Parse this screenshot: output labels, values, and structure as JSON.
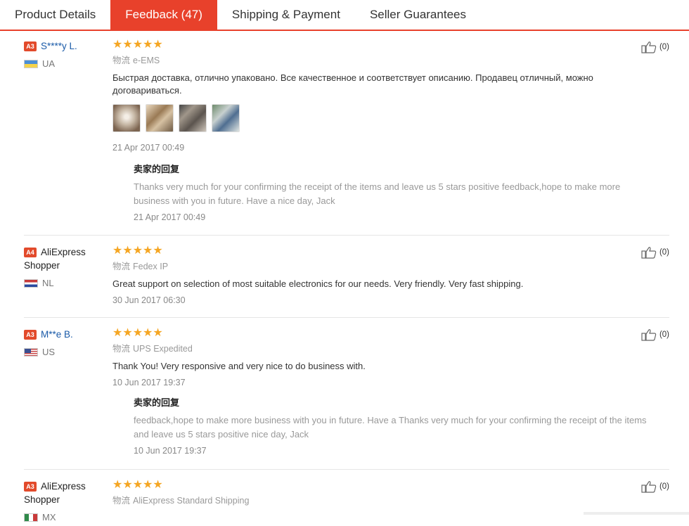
{
  "tabs": [
    {
      "label": "Product Details"
    },
    {
      "label": "Feedback (47)"
    },
    {
      "label": "Shipping & Payment"
    },
    {
      "label": "Seller Guarantees"
    }
  ],
  "rating_stars": "★★★★★",
  "shipping_label": "物流",
  "reply_title": "卖家的回复",
  "reviews": [
    {
      "badge": "A3",
      "name": "S****y L.",
      "country": "UA",
      "shipping": "e-EMS",
      "text": "Быстрая доставка, отлично упаковано. Все качественное и соответствует описанию. Продавец отличный, можно договариваться.",
      "date": "21 Apr 2017 00:49",
      "reply_text": "Thanks very much for your confirming the receipt of the items and leave us 5 stars positive feedback,hope to make more business with you in future. Have a nice day, Jack",
      "reply_date": "21 Apr 2017 00:49",
      "likes": "(0)"
    },
    {
      "badge": "A4",
      "name": "AliExpress Shopper",
      "country": "NL",
      "shipping": "Fedex IP",
      "text": "Great support on selection of most suitable electronics for our needs. Very friendly. Very fast shipping.",
      "date": "30 Jun 2017 06:30",
      "likes": "(0)"
    },
    {
      "badge": "A3",
      "name": "M**e B.",
      "country": "US",
      "shipping": "UPS Expedited",
      "text": "Thank You! Very responsive and very nice to do business with.",
      "date": "10 Jun 2017 19:37",
      "reply_text": "feedback,hope to make more business with you in future. Have a Thanks very much for your confirming the receipt of the items and leave us 5 stars positive nice day, Jack",
      "reply_date": "10 Jun 2017 19:37",
      "likes": "(0)"
    },
    {
      "badge": "A3",
      "name": "AliExpress Shopper",
      "country": "MX",
      "shipping": "AliExpress Standard Shipping",
      "likes": "(0)"
    }
  ]
}
